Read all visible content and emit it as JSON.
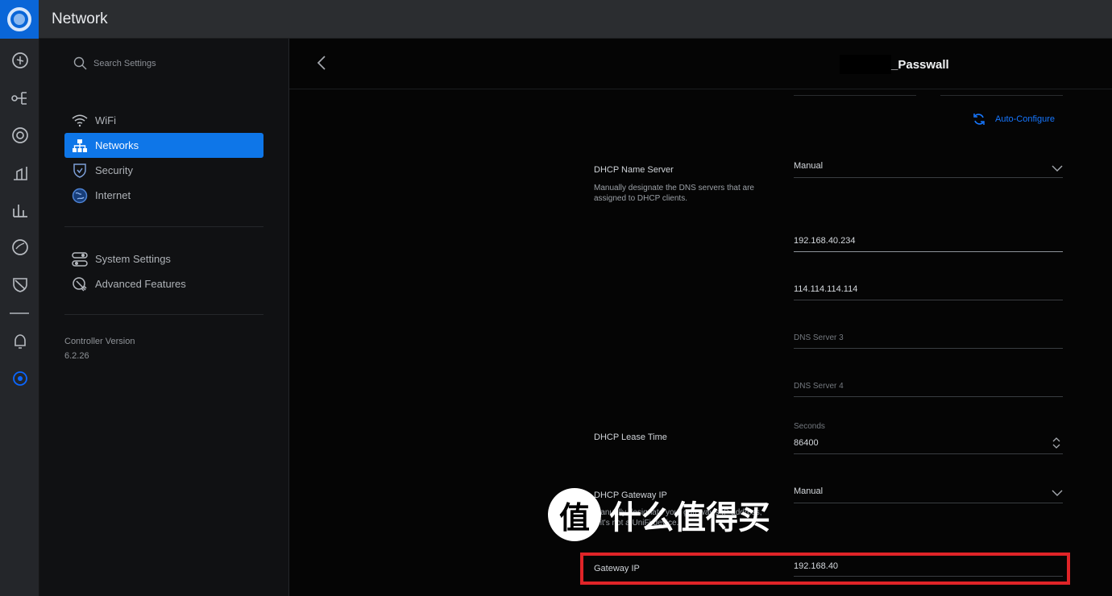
{
  "app": {
    "title": "Network"
  },
  "rail": {
    "icons": [
      "dashboard-icon",
      "topology-icon",
      "devices-icon",
      "statistics-icon",
      "insights-icon",
      "shield-icon",
      "events-icon",
      "notifications-icon",
      "settings-icon"
    ]
  },
  "settings": {
    "search_placeholder": "Search Settings",
    "nav": [
      {
        "label": "WiFi",
        "icon": "wifi-icon"
      },
      {
        "label": "Networks",
        "icon": "network-tree-icon"
      },
      {
        "label": "Security",
        "icon": "shield-check-icon"
      },
      {
        "label": "Internet",
        "icon": "globe-icon"
      }
    ],
    "secondary": [
      {
        "label": "System Settings",
        "icon": "toggle-icon"
      },
      {
        "label": "Advanced Features",
        "icon": "advanced-icon"
      }
    ],
    "controller_version_label": "Controller Version",
    "controller_version": "6.2.26"
  },
  "page": {
    "title": "_Passwall",
    "auto_configure": "Auto-Configure",
    "dhcp_name_server": {
      "label": "DHCP Name Server",
      "help": "Manually designate the DNS servers that are assigned to DHCP clients.",
      "mode": "Manual",
      "dns1": "192.168.40.234",
      "dns2": "114.114.114.114",
      "dns3_placeholder": "DNS Server 3",
      "dns4_placeholder": "DNS Server 4"
    },
    "lease_time": {
      "label": "DHCP Lease Time",
      "unit": "Seconds",
      "value": "86400"
    },
    "gateway": {
      "label": "DHCP Gateway IP",
      "help": "Manually designate your gateway's IP address, if it's not a UniFi device.",
      "mode": "Manual",
      "ip_label": "Gateway IP",
      "ip_value": "192.168.40"
    }
  },
  "watermark": {
    "badge": "值",
    "text": "什么值得买"
  },
  "colors": {
    "accent": "#0e76e8",
    "highlight": "#e02428",
    "logo": "#0a66d8"
  }
}
